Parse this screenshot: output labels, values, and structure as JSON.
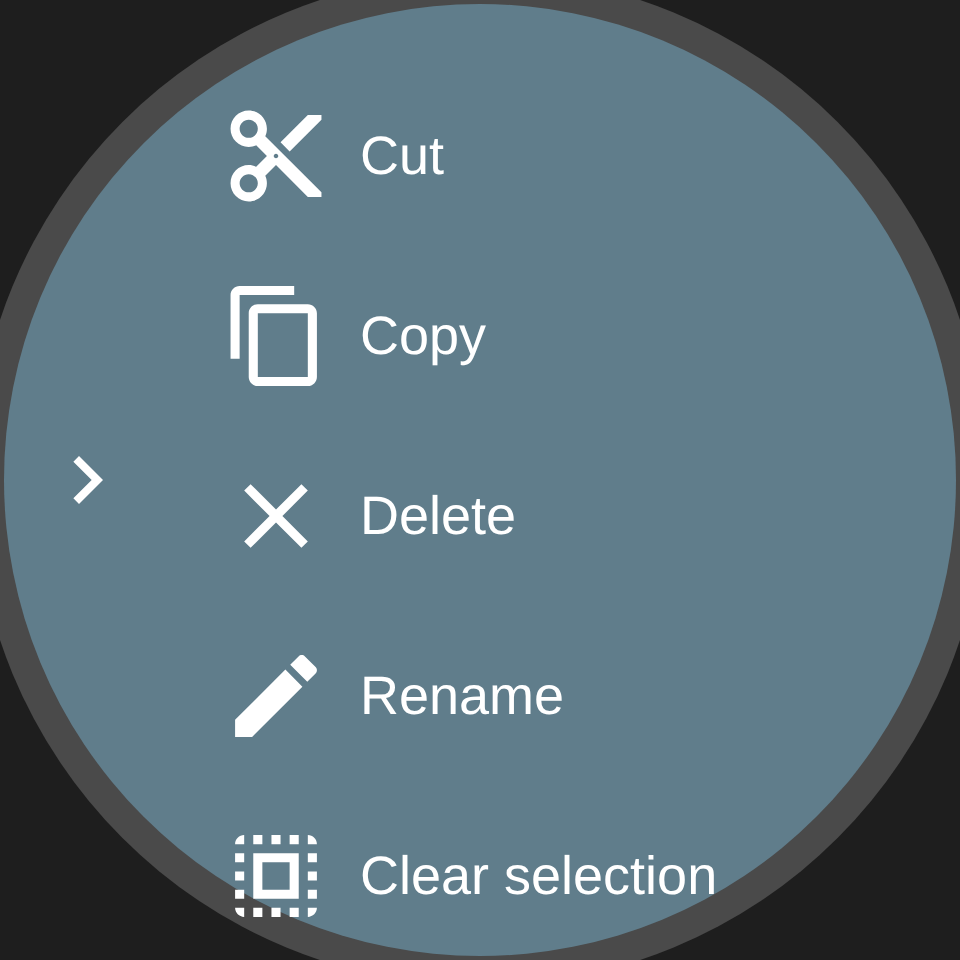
{
  "menu": {
    "items": [
      {
        "label": "Cut",
        "kind": "cut"
      },
      {
        "label": "Copy",
        "kind": "copy"
      },
      {
        "label": "Delete",
        "kind": "delete"
      },
      {
        "label": "Rename",
        "kind": "rename"
      },
      {
        "label": "Clear selection",
        "kind": "clear"
      }
    ]
  }
}
